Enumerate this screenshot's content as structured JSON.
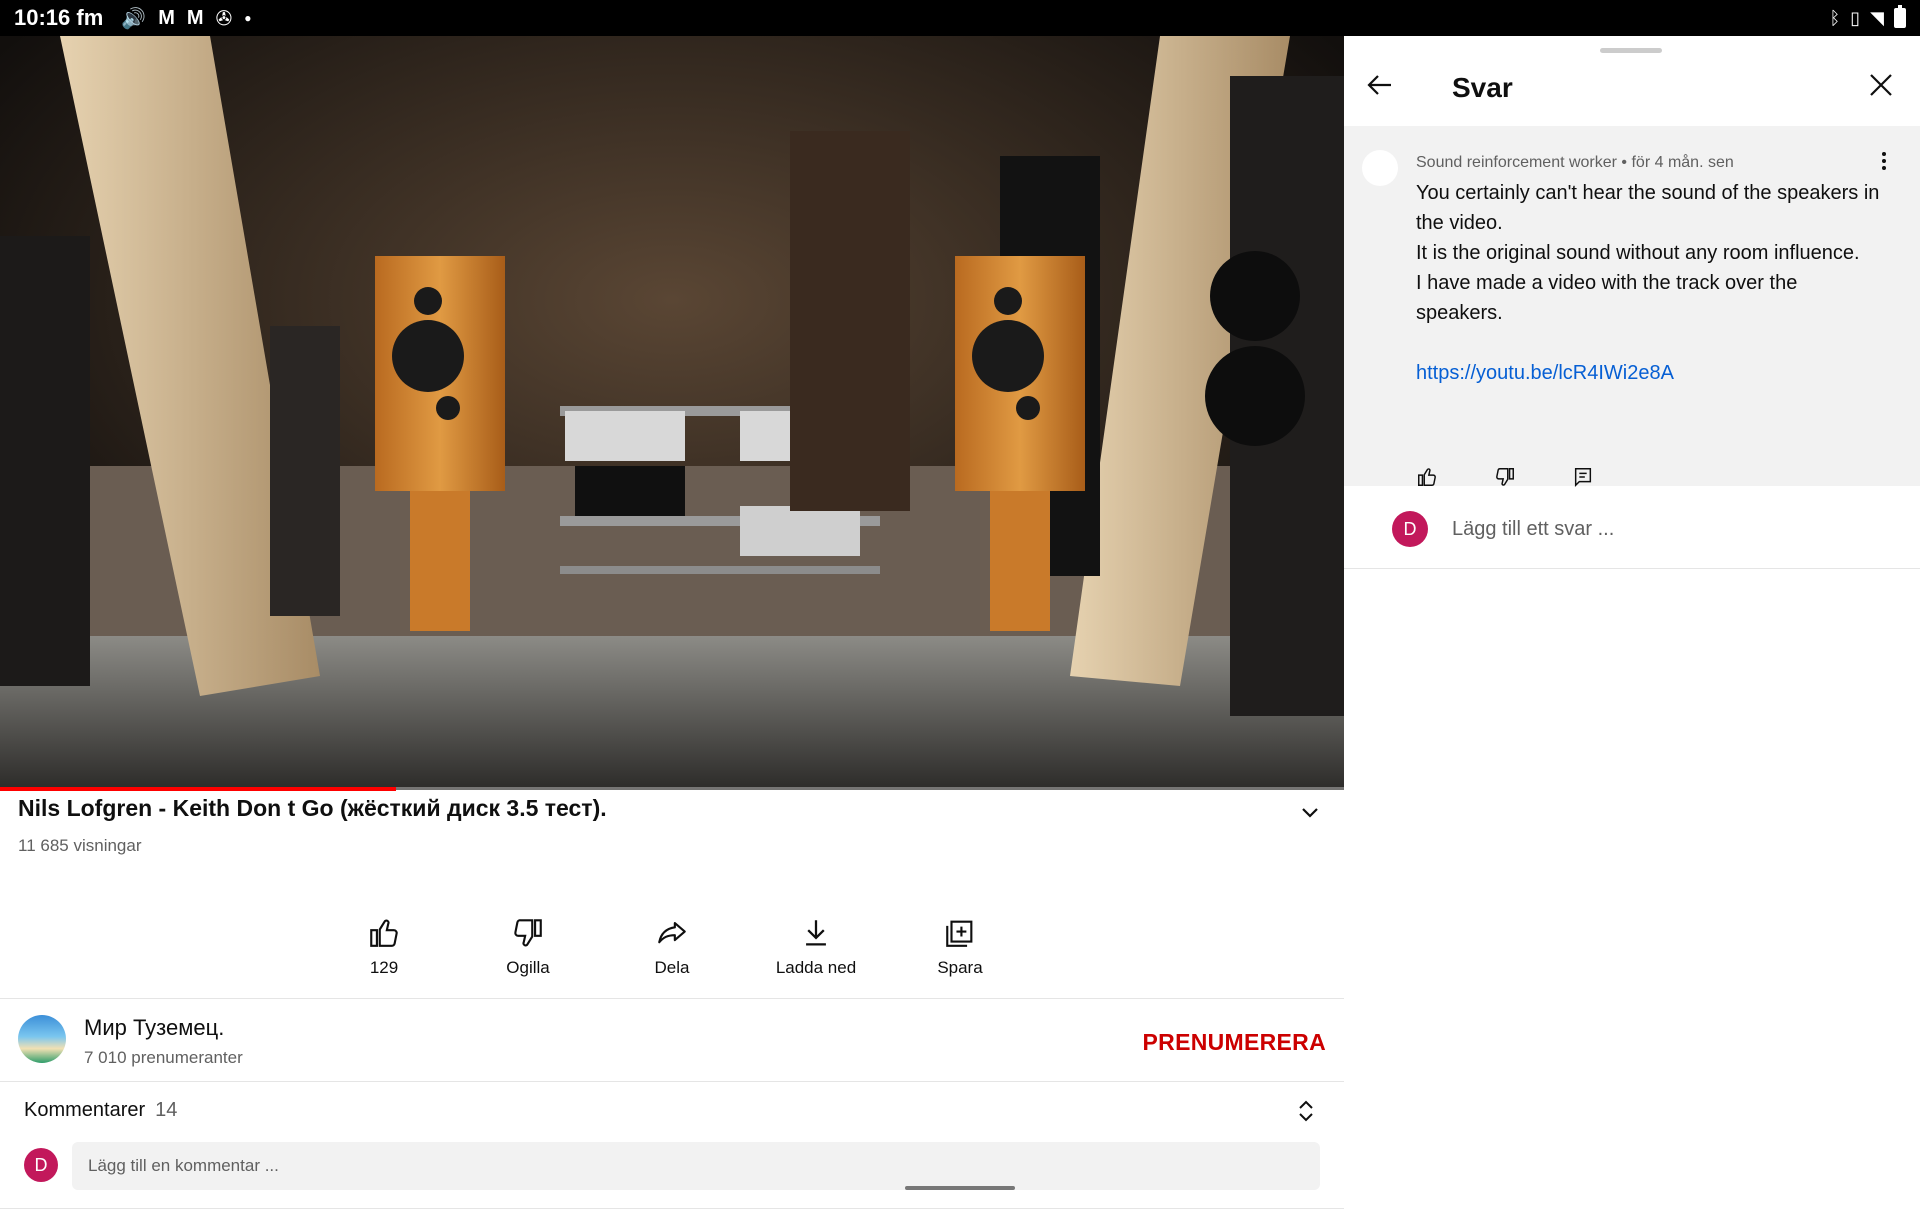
{
  "status_bar": {
    "time": "10:16 fm",
    "icons_left": [
      "volume-icon",
      "gmail-icon",
      "gmail-icon",
      "aperture-icon",
      "dot-icon"
    ],
    "icons_right": [
      "bluetooth-icon",
      "vibrate-icon",
      "wifi-icon",
      "battery-icon"
    ]
  },
  "video": {
    "progress": 0.295
  },
  "info": {
    "title": "Nils Lofgren - Keith Don t Go (жёсткий диск 3.5 тест).",
    "views": "11 685 visningar"
  },
  "actions": [
    {
      "label": "129",
      "icon": "like-icon"
    },
    {
      "label": "Ogilla",
      "icon": "dislike-icon"
    },
    {
      "label": "Dela",
      "icon": "share-icon"
    },
    {
      "label": "Ladda ned",
      "icon": "download-icon"
    },
    {
      "label": "Spara",
      "icon": "save-icon"
    }
  ],
  "channel": {
    "name": "Мир Туземец.",
    "subscribers": "7 010 prenumeranter",
    "subscribe_label": "PRENUMERERA"
  },
  "comments": {
    "label": "Kommentarer",
    "count": "14",
    "avatar_letter": "D",
    "input_placeholder": "Lägg till en kommentar ..."
  },
  "panel": {
    "title": "Svar",
    "reply": {
      "meta": "Sound reinforcement worker • för 4 mån. sen",
      "lines": [
        "You certainly can't hear the sound of the speakers in the video.",
        "It is the original sound without any room influence.",
        "I have made a video with the track over the speakers."
      ],
      "link": "https://youtu.be/lcR4IWi2e8A"
    },
    "avatar_letter": "D",
    "add_reply_placeholder": "Lägg till ett svar ..."
  },
  "colors": {
    "accent_red": "#cc0000",
    "progress_red": "#ff0000",
    "link_blue": "#065fd4",
    "avatar_pink": "#c2185b"
  }
}
